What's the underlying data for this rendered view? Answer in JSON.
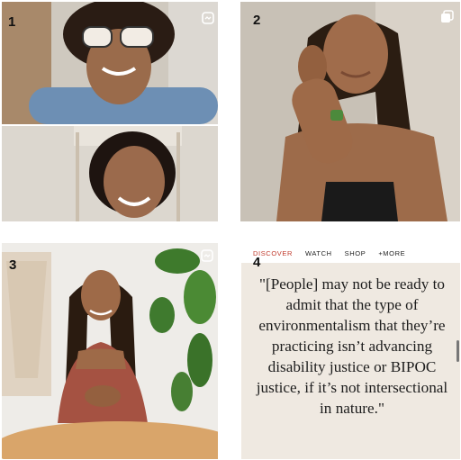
{
  "tiles": [
    {
      "number": "1"
    },
    {
      "number": "2"
    },
    {
      "number": "3"
    },
    {
      "number": "4"
    }
  ],
  "nav": {
    "discover": "DISCOVER",
    "watch": "WATCH",
    "shop": "SHOP",
    "more": "+MORE"
  },
  "quote": "\"[People] may not be ready to admit that the type of environmentalism that they’re practicing isn’t advancing disability justice or BIPOC justice, if it’s not intersectional in nature.\"",
  "colors": {
    "accent": "#c0392b",
    "quote_background": "#efe9e1"
  },
  "icons": {
    "tile1": "carousel-icon",
    "tile2": "multiple-images-icon",
    "tile3": "carousel-icon"
  }
}
